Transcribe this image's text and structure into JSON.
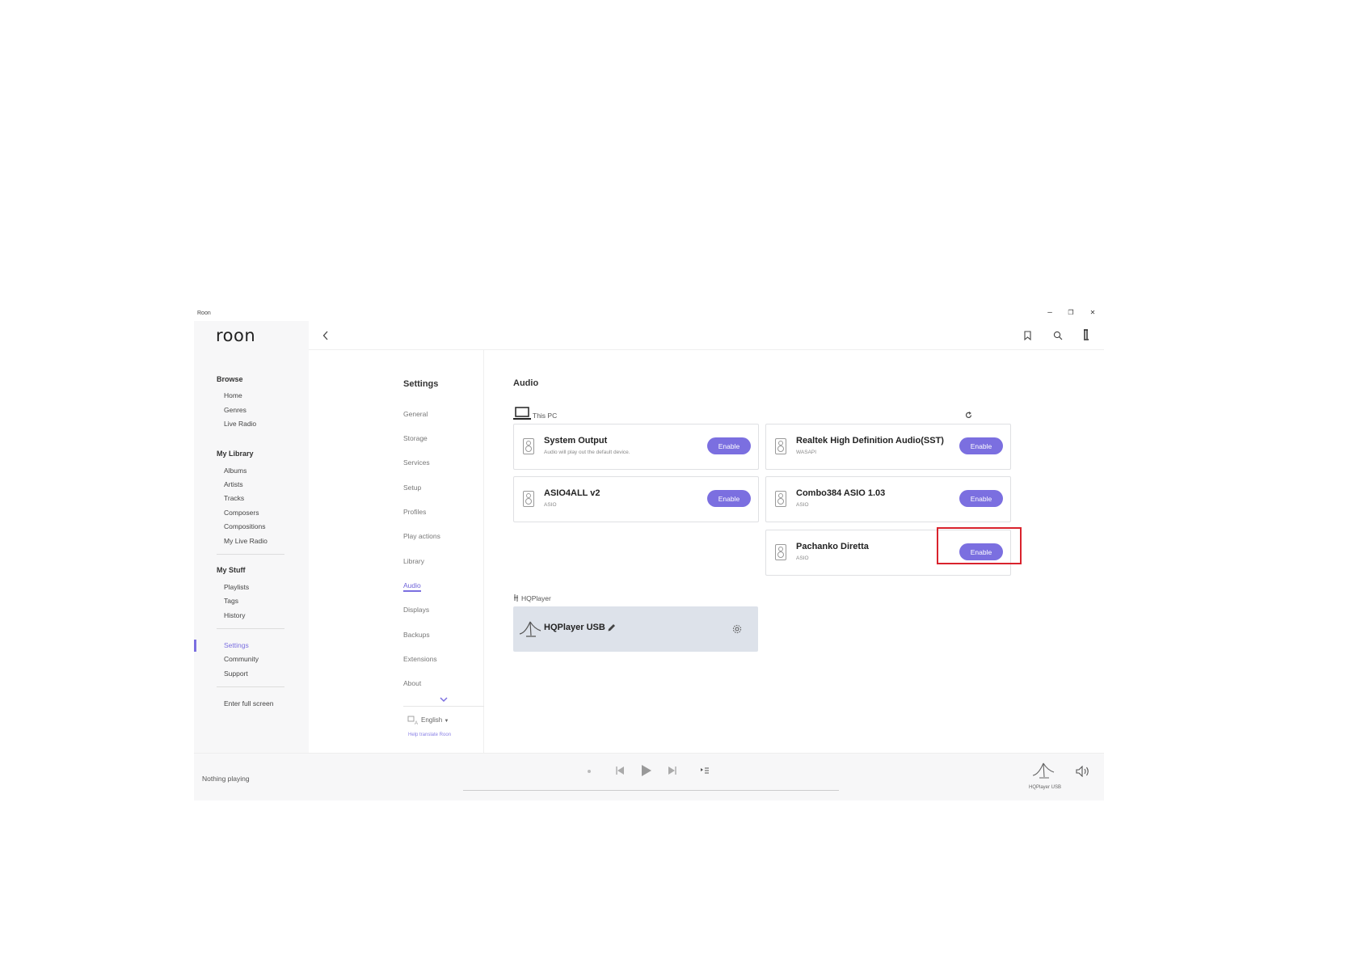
{
  "window": {
    "app_name": "Roon",
    "minimize": "–",
    "restore": "❐",
    "close": "✕"
  },
  "sidebar": {
    "logo": "roon",
    "browse_head": "Browse",
    "browse": [
      "Home",
      "Genres",
      "Live Radio"
    ],
    "library_head": "My Library",
    "library": [
      "Albums",
      "Artists",
      "Tracks",
      "Composers",
      "Compositions",
      "My Live Radio"
    ],
    "stuff_head": "My Stuff",
    "stuff": [
      "Playlists",
      "Tags",
      "History"
    ],
    "extra": [
      "Settings",
      "Community",
      "Support"
    ],
    "fullscreen": "Enter full screen"
  },
  "topbar": {
    "back_icon": "chevron-left-icon",
    "bookmark_icon": "bookmark-icon",
    "search_icon": "search-icon",
    "profile_icon": "profile-icon"
  },
  "settings": {
    "title": "Settings",
    "items": [
      "General",
      "Storage",
      "Services",
      "Setup",
      "Profiles",
      "Play actions",
      "Library",
      "Audio",
      "Displays",
      "Backups",
      "Extensions",
      "About"
    ],
    "active": "Audio",
    "language": "English",
    "help_translate": "Help translate Roon"
  },
  "audio": {
    "title": "Audio",
    "this_pc_label": "This PC",
    "refresh_icon": "refresh-icon",
    "devices": [
      {
        "name": "System Output",
        "sub": "Audio will play out the default device.",
        "button": "Enable"
      },
      {
        "name": "Realtek High Definition Audio(SST)",
        "sub": "WASAPI",
        "button": "Enable"
      },
      {
        "name": "ASIO4ALL v2",
        "sub": "ASIO",
        "button": "Enable"
      },
      {
        "name": "Combo384 ASIO 1.03",
        "sub": "ASIO",
        "button": "Enable"
      },
      {
        "name": "Pachanko Diretta",
        "sub": "ASIO",
        "button": "Enable"
      }
    ],
    "hqplayer_label": "HQPlayer",
    "hqplayer_device": "HQPlayer USB"
  },
  "nowplaying": {
    "status": "Nothing playing",
    "zone": "HQPlayer USB"
  },
  "colors": {
    "accent": "#7b6fe0",
    "highlight": "#d9232d"
  }
}
